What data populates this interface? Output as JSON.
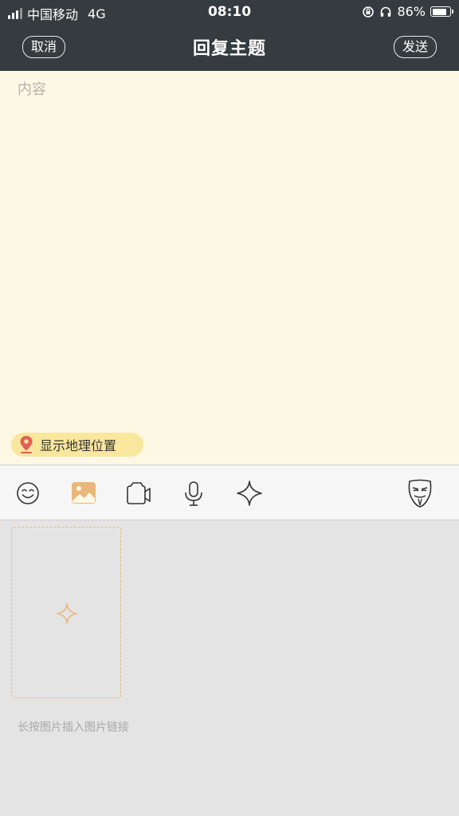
{
  "status_bar": {
    "carrier": "中国移动",
    "network": "4G",
    "time": "08:10",
    "battery_percent": "86%",
    "battery_level": 0.86,
    "icons": [
      "signal-icon",
      "rotation-lock-icon",
      "headphones-icon",
      "battery-icon"
    ]
  },
  "nav": {
    "cancel_label": "取消",
    "title": "回复主题",
    "send_label": "发送"
  },
  "editor": {
    "placeholder": "内容"
  },
  "location": {
    "label": "显示地理位置"
  },
  "toolbar": {
    "items": [
      "emoji-icon",
      "image-icon",
      "video-icon",
      "microphone-icon",
      "more-plus-icon",
      "anonymous-mask-icon"
    ],
    "active_item": "image-icon"
  },
  "attachments": {
    "hint": "长按图片插入图片链接"
  },
  "colors": {
    "header_bg": "#353b3f",
    "content_bg": "#fcf8e4",
    "accent": "#e9b77a",
    "location_chip_bg": "#fae79e",
    "location_pin": "#e0605a",
    "panel_bg": "#e4e4e4"
  }
}
